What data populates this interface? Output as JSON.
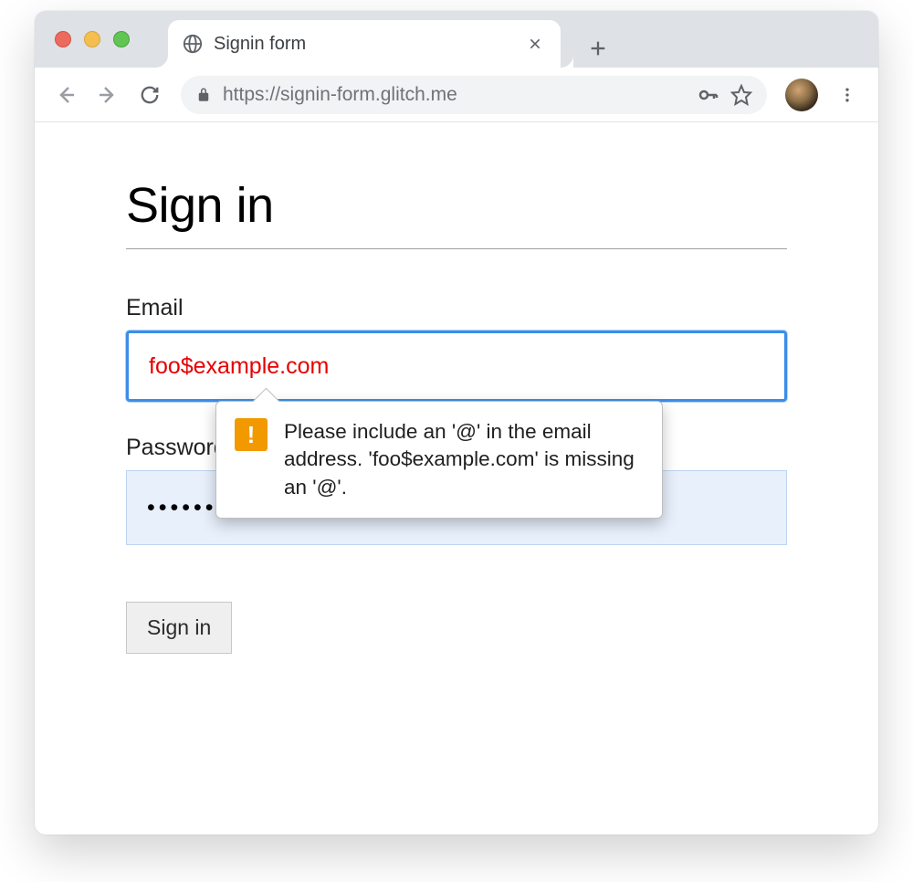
{
  "browser": {
    "tab_title": "Signin form",
    "url": "https://signin-form.glitch.me"
  },
  "page": {
    "heading": "Sign in",
    "email_label": "Email",
    "email_value": "foo$example.com",
    "password_label": "Password",
    "password_value": "•••••••••••",
    "submit_label": "Sign in"
  },
  "validation": {
    "message": "Please include an '@' in the email address. 'foo$example.com' is missing an '@'."
  }
}
